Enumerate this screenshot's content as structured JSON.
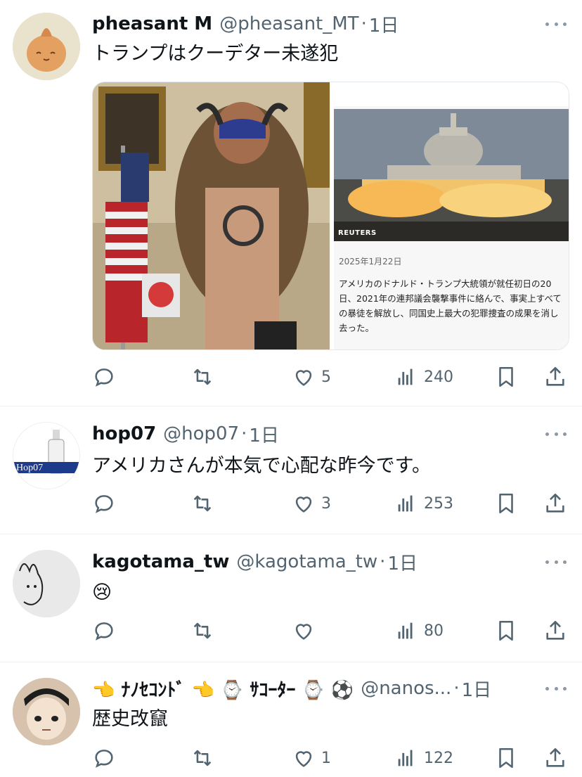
{
  "posts": [
    {
      "name": "pheasant M",
      "handle": "@pheasant_MT",
      "sep": "·",
      "time": "1日",
      "text": "トランプはクーデター未遂犯",
      "likes": "5",
      "views": "240",
      "media": {
        "credit": "REUTERS",
        "date": "2025年1月22日",
        "body": "アメリカのドナルド・トランプ大統領が就任初日の20日、2021年の連邦議会襲撃事件に絡んで、事実上すべての暴徒を解放し、同国史上最大の犯罪捜査の成果を消し去った。"
      }
    },
    {
      "name": "hop07",
      "handle": "@hop07",
      "sep": "·",
      "time": "1日",
      "text": "アメリカさんが本気で心配な昨今です。",
      "likes": "3",
      "views": "253",
      "avatar_text": "Hop07"
    },
    {
      "name": "kagotama_tw",
      "handle": "@kagotama_tw",
      "sep": "·",
      "time": "1日",
      "text": "😢",
      "likes": "",
      "views": "80"
    },
    {
      "name": "👈 ﾅﾉｾｺﾝﾄﾞ 👈 ⌚ ｻｺｰﾀｰ ⌚ ⚽",
      "handle": "@nanos...",
      "sep": "·",
      "time": "1日",
      "text": "歴史改竄",
      "likes": "1",
      "views": "122"
    }
  ],
  "icons": {
    "reply": "reply-icon",
    "repost": "repost-icon",
    "like": "heart-icon",
    "views": "views-icon",
    "bookmark": "bookmark-icon",
    "share": "share-icon",
    "more": "more-icon"
  },
  "colors": {
    "text": "#0f1419",
    "secondary": "#536471",
    "divider": "#eff3f4"
  }
}
